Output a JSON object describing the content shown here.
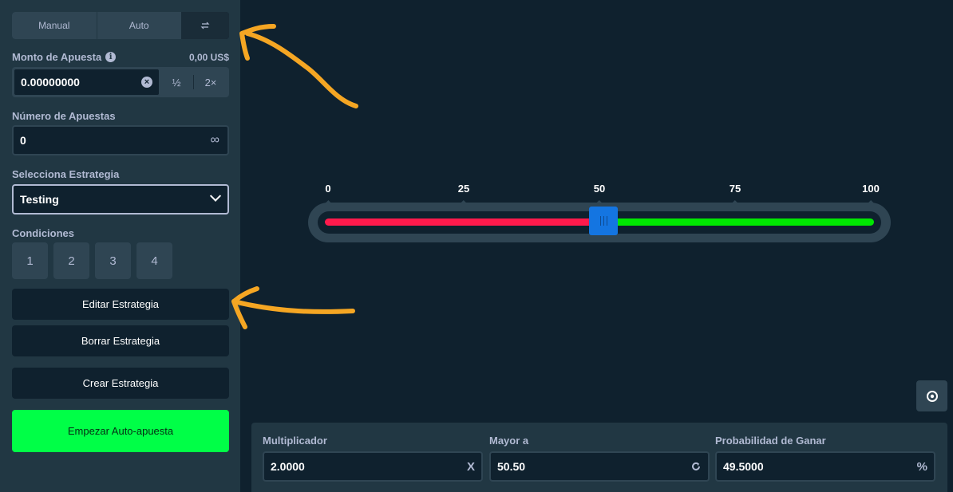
{
  "tabs": {
    "manual": "Manual",
    "auto": "Auto"
  },
  "bet": {
    "label": "Monto de Apuesta",
    "balance": "0,00 US$",
    "value": "0.00000000",
    "half": "½",
    "double": "2×"
  },
  "num_bets": {
    "label": "Número de Apuestas",
    "value": "0",
    "suffix": "∞"
  },
  "strategy": {
    "label": "Selecciona Estrategia",
    "value": "Testing"
  },
  "conditions": {
    "label": "Condiciones",
    "items": [
      "1",
      "2",
      "3",
      "4"
    ]
  },
  "buttons": {
    "edit": "Editar Estrategia",
    "delete": "Borrar Estrategia",
    "create": "Crear Estrategia",
    "start": "Empezar Auto-apuesta"
  },
  "slider": {
    "ticks": [
      "0",
      "25",
      "50",
      "75",
      "100"
    ],
    "value": 50.5,
    "colors": {
      "lose": "#ff1a4c",
      "win": "#00e701",
      "handle": "#1475e1"
    }
  },
  "bottom": {
    "multiplier": {
      "label": "Multiplicador",
      "value": "2.0000",
      "suffix": "X"
    },
    "roll_over": {
      "label": "Mayor a",
      "value": "50.50"
    },
    "win_chance": {
      "label": "Probabilidad de Ganar",
      "value": "49.5000",
      "suffix": "%"
    }
  },
  "accent": {
    "arrow": "#f5a623",
    "start_button": "#00ff47"
  }
}
